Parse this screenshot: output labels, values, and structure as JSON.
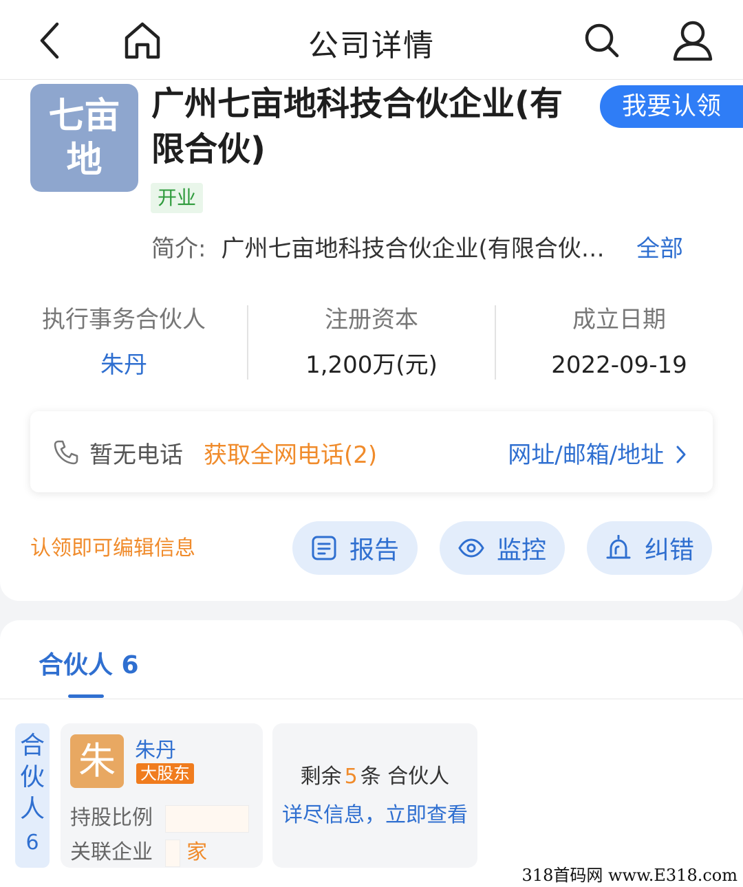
{
  "nav": {
    "title": "公司详情"
  },
  "company": {
    "logo_lines": [
      "七亩",
      "地"
    ],
    "name": "广州七亩地科技合伙企业(有限合伙)",
    "claim_label": "我要认领",
    "status": "开业",
    "intro_label": "简介:",
    "intro_text": "广州七亩地科技合伙企业(有限合伙…",
    "intro_more": "全部"
  },
  "stats": [
    {
      "label": "执行事务合伙人",
      "value": "朱丹"
    },
    {
      "label": "注册资本",
      "value": "1,200万(元)"
    },
    {
      "label": "成立日期",
      "value": "2022-09-19"
    }
  ],
  "contact": {
    "no_phone": "暂无电话",
    "get_phone": "获取全网电话(2)",
    "addr_link": "网址/邮箱/地址"
  },
  "actions": {
    "edit_tip": "认领即可编辑信息",
    "report": "报告",
    "monitor": "监控",
    "correct": "纠错"
  },
  "partners": {
    "tab_label": "合伙人 6",
    "side_label_chars": [
      "合",
      "伙",
      "人"
    ],
    "side_count": "6",
    "first": {
      "avatar": "朱",
      "name": "朱丹",
      "badge": "大股东",
      "share_label": "持股比例",
      "related_label": "关联企业",
      "related_suffix": "家"
    },
    "remaining_prefix": "剩余",
    "remaining_count": "5",
    "remaining_suffix": "条 合伙人",
    "remaining_link": "详尽信息，立即查看"
  },
  "watermark": "318首码网 www.E318.com"
}
